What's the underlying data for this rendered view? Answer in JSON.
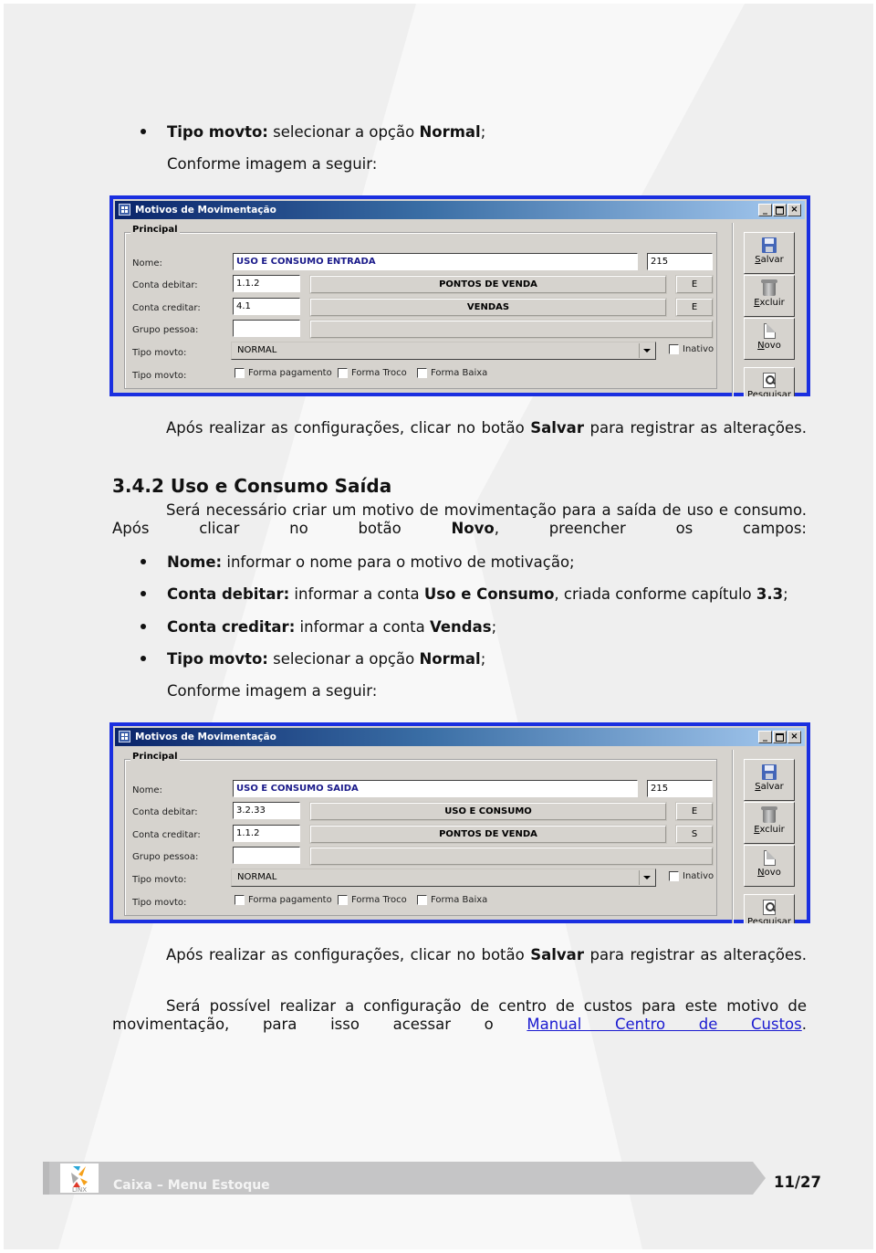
{
  "intro": {
    "bullet_tipo": {
      "label": "Tipo movto:",
      "text_a": " selecionar a opção ",
      "bold": "Normal",
      "text_b": ";"
    },
    "caption": "Conforme imagem a seguir:"
  },
  "window1": {
    "title": "Motivos de Movimentação",
    "controls": {
      "minimize": "_",
      "maximize": "",
      "close": "×"
    },
    "group_label": "Principal",
    "labels": {
      "nome": "Nome:",
      "conta_debitar": "Conta debitar:",
      "conta_creditar": "Conta creditar:",
      "grupo_pessoa": "Grupo pessoa:",
      "tipo_movto": "Tipo movto:",
      "tipo_movto_2": "Tipo movto:"
    },
    "nome_value": "USO E CONSUMO ENTRADA",
    "codigo_value": "215",
    "conta_debitar": {
      "code": "1.1.2",
      "name": "PONTOS DE VENDA",
      "flag": "E"
    },
    "conta_creditar": {
      "code": "4.1",
      "name": "VENDAS",
      "flag": "E"
    },
    "grupo_pessoa": {
      "code": "",
      "name": ""
    },
    "tipo_movto_selected": "NORMAL",
    "inativo_label": "Inativo",
    "checkboxes": [
      {
        "label": "Forma pagamento",
        "checked": false
      },
      {
        "label": "Forma Troco",
        "checked": false
      },
      {
        "label": "Forma Baixa",
        "checked": false
      }
    ],
    "toolbar": [
      {
        "icon": "save-icon",
        "accel": "S",
        "rest": "alvar"
      },
      {
        "icon": "trash-icon",
        "accel": "E",
        "rest": "xcluir"
      },
      {
        "icon": "new-document-icon",
        "accel": "N",
        "rest": "ovo"
      },
      {
        "icon": "search-icon",
        "accel": "P",
        "rest": "esquisar"
      }
    ]
  },
  "after1": {
    "text_a": "Após realizar as configurações, clicar no botão ",
    "bold": "Salvar",
    "text_b": " para registrar as alterações."
  },
  "section": {
    "heading": "3.4.2 Uso e Consumo Saída",
    "intro_a": "Será necessário criar um motivo de movimentação para a saída de uso e consumo. Após clicar no botão ",
    "intro_bold": "Novo",
    "intro_b": ", preencher os campos:",
    "bullets": [
      {
        "label": "Nome:",
        "parts": [
          " informar o nome para o motivo de motivação;"
        ]
      },
      {
        "label": "Conta debitar:",
        "parts": [
          " informar a conta ",
          "Uso e Consumo",
          ", criada conforme capítulo ",
          "3.3",
          ";"
        ]
      },
      {
        "label": "Conta creditar:",
        "parts": [
          " informar a conta ",
          "Vendas",
          ";"
        ]
      },
      {
        "label": "Tipo movto:",
        "parts": [
          " selecionar a opção ",
          "Normal",
          ";"
        ]
      }
    ],
    "caption": "Conforme imagem a seguir:"
  },
  "window2": {
    "title": "Motivos de Movimentação",
    "controls": {
      "minimize": "_",
      "maximize": "",
      "close": "×"
    },
    "group_label": "Principal",
    "labels": {
      "nome": "Nome:",
      "conta_debitar": "Conta debitar:",
      "conta_creditar": "Conta creditar:",
      "grupo_pessoa": "Grupo pessoa:",
      "tipo_movto": "Tipo movto:",
      "tipo_movto_2": "Tipo movto:"
    },
    "nome_value": "USO E CONSUMO SAIDA",
    "codigo_value": "215",
    "conta_debitar": {
      "code": "3.2.33",
      "name": "USO E CONSUMO",
      "flag": "E"
    },
    "conta_creditar": {
      "code": "1.1.2",
      "name": "PONTOS DE VENDA",
      "flag": "S"
    },
    "grupo_pessoa": {
      "code": "",
      "name": ""
    },
    "tipo_movto_selected": "NORMAL",
    "inativo_label": "Inativo",
    "checkboxes": [
      {
        "label": "Forma pagamento",
        "checked": false
      },
      {
        "label": "Forma Troco",
        "checked": false
      },
      {
        "label": "Forma Baixa",
        "checked": false
      }
    ],
    "toolbar": [
      {
        "icon": "save-icon",
        "accel": "S",
        "rest": "alvar"
      },
      {
        "icon": "trash-icon",
        "accel": "E",
        "rest": "xcluir"
      },
      {
        "icon": "new-document-icon",
        "accel": "N",
        "rest": "ovo"
      },
      {
        "icon": "search-icon",
        "accel": "P",
        "rest": "esquisar"
      }
    ]
  },
  "after2": {
    "text_a": "Após realizar as configurações, clicar no botão ",
    "bold": "Salvar",
    "text_b": " para registrar as alterações."
  },
  "cost_center": {
    "text_a": "Será possível realizar a configuração de centro de custos para este motivo de movimentação, para isso acessar o ",
    "link": "Manual Centro de Custos",
    "text_b": "."
  },
  "footer": {
    "logo_text": "LINX",
    "title": "Caixa – Menu Estoque",
    "page": "11/27"
  },
  "colors": {
    "window_border": "#1a2fe0",
    "title_bar_start": "#0a246a",
    "link": "#1a1ad0",
    "footer_bar": "#c5c5c6"
  }
}
